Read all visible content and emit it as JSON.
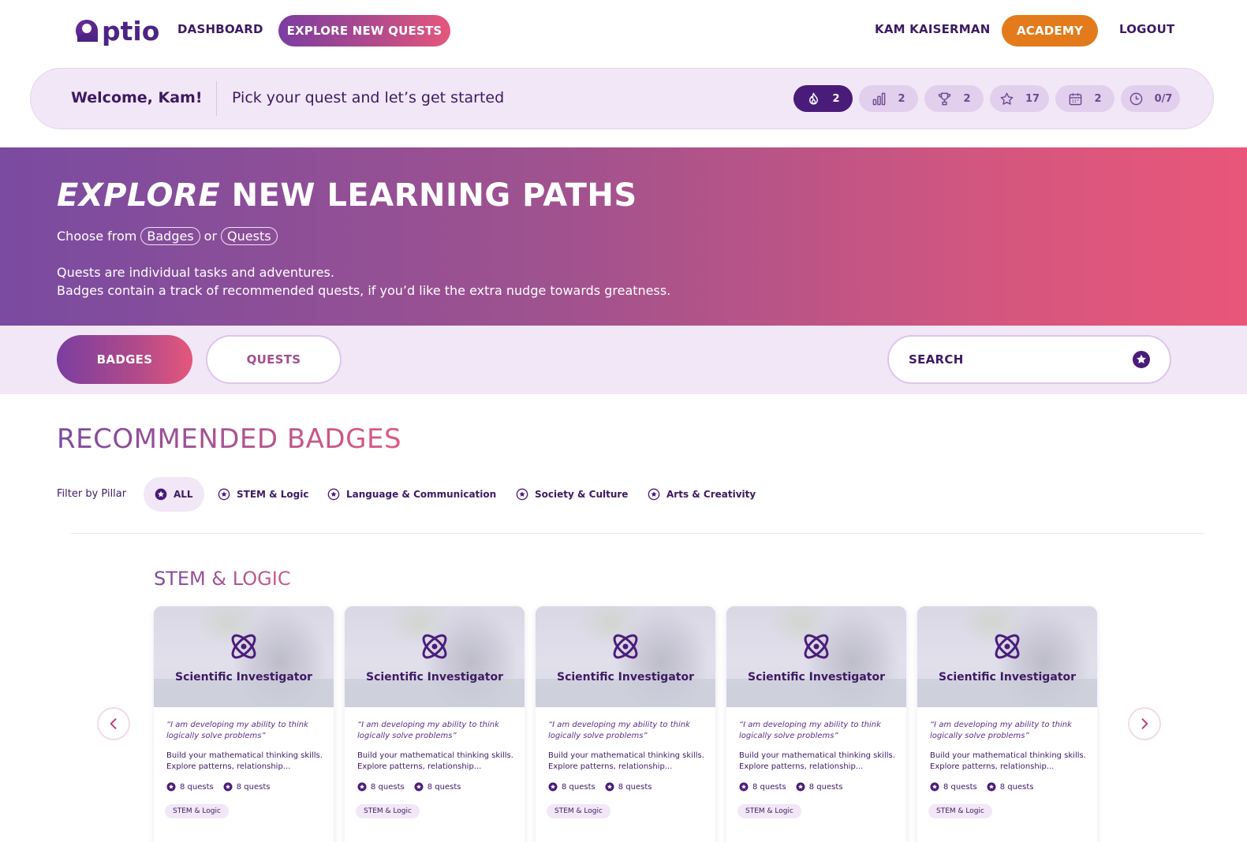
{
  "nav": {
    "logo_text": "ptio",
    "dashboard": "DASHBOARD",
    "explore": "EXPLORE NEW QUESTS",
    "user": "KAM KAISERMAN",
    "academy": "ACADEMY",
    "logout": "LOGOUT"
  },
  "welcome": {
    "greeting": "Welcome, Kam!",
    "message": "Pick your quest and let’s get started",
    "stats": [
      {
        "icon": "flame-icon",
        "value": "2"
      },
      {
        "icon": "bar-chart-icon",
        "value": "2"
      },
      {
        "icon": "trophy-icon",
        "value": "2"
      },
      {
        "icon": "star-icon",
        "value": "17"
      },
      {
        "icon": "calendar-icon",
        "value": "2"
      },
      {
        "icon": "clock-icon",
        "value": "0/7"
      }
    ]
  },
  "hero": {
    "title_em": "EXPLORE",
    "title_rest": " NEW LEARNING PATHS",
    "choose_prefix": "Choose from",
    "chip_badges": "Badges",
    "or": "or",
    "chip_quests": "Quests",
    "line1": "Quests are individual tasks and adventures.",
    "line2": "Badges contain a track of recommended quests, if you’d like the extra nudge towards greatness."
  },
  "tabs": {
    "badges": "BADGES",
    "quests": "QUESTS",
    "search": "SEARCH"
  },
  "recommended": {
    "title": "RECOMMENDED BADGES",
    "filter_label": "Filter by Pillar",
    "filters": [
      "ALL",
      "STEM & Logic",
      "Language & Communication",
      "Society & Culture",
      "Arts & Creativity"
    ]
  },
  "section": {
    "title": "STEM & LOGIC",
    "cards": [
      {
        "title": "Scientific Investigator",
        "quote": "“I am developing my ability to think logically solve problems”",
        "desc": "Build your mathematical thinking skills. Explore patterns, relationship...",
        "meta1": "8 quests",
        "meta2": "8 quests",
        "tag": "STEM & Logic"
      },
      {
        "title": "Scientific Investigator",
        "quote": "“I am developing my ability to think logically solve problems”",
        "desc": "Build your mathematical thinking skills. Explore patterns, relationship...",
        "meta1": "8 quests",
        "meta2": "8 quests",
        "tag": "STEM & Logic"
      },
      {
        "title": "Scientific Investigator",
        "quote": "“I am developing my ability to think logically solve problems”",
        "desc": "Build your mathematical thinking skills. Explore patterns, relationship...",
        "meta1": "8 quests",
        "meta2": "8 quests",
        "tag": "STEM & Logic"
      },
      {
        "title": "Scientific Investigator",
        "quote": "“I am developing my ability to think logically solve problems”",
        "desc": "Build your mathematical thinking skills. Explore patterns, relationship...",
        "meta1": "8 quests",
        "meta2": "8 quests",
        "tag": "STEM & Logic"
      },
      {
        "title": "Scientific Investigator",
        "quote": "“I am developing my ability to think logically solve problems”",
        "desc": "Build your mathematical thinking skills. Explore patterns, relationship...",
        "meta1": "8 quests",
        "meta2": "8 quests",
        "tag": "STEM & Logic"
      }
    ]
  },
  "colors": {
    "brand_purple": "#4a1c7a",
    "brand_pink": "#e5577c",
    "academy_orange": "#e37b1c",
    "lavender": "#f2e7f6"
  }
}
